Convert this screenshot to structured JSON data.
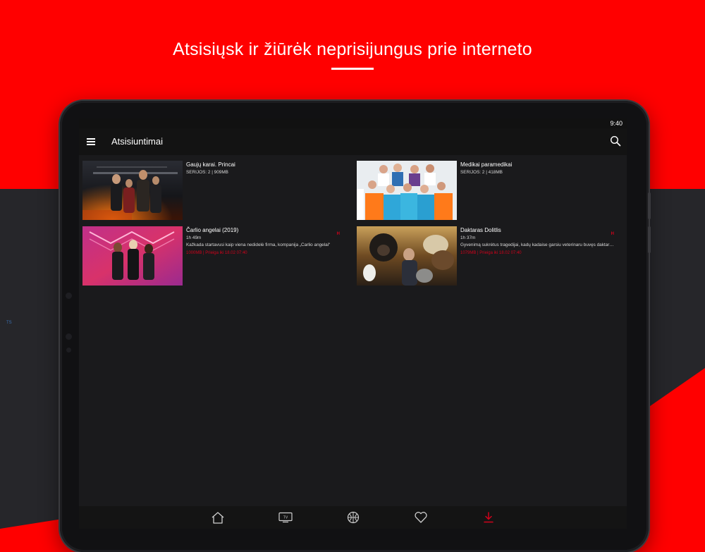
{
  "headline": "Atsisiųsk ir žiūrėk neprisijungus prie interneto",
  "status": {
    "time": "9:40"
  },
  "tablet": {
    "side_label": "TS"
  },
  "appbar": {
    "title": "Atsisiuntimai",
    "menu_icon": "hamburger-menu-icon",
    "search_icon": "search-icon"
  },
  "downloads": [
    {
      "title": "Gaujų karai. Princai",
      "meta": "SERIJOS: 2 | 909MB"
    },
    {
      "title": "Medikai paramedikai",
      "meta": "SERIJOS: 2 | 418MB"
    },
    {
      "title": "Čarlio angelai (2019)",
      "duration": "1h 49m",
      "description": "Kažkada startavusi kaip viena nedidelė firma, kompanija „Čarlio angelai“",
      "red": "1000MB | Prieiga iki 18.02 07:40",
      "badge": "H"
    },
    {
      "title": "Daktaras Dolitlis",
      "duration": "1h 37m",
      "description": "Gyvenimą sukrėtus tragedijai, kadų kadaise garsiu veterinaru buvęs daktaras",
      "red": "1079MB | Prieiga iki 18.02 07:40",
      "badge": "H"
    }
  ],
  "bottom_nav": [
    {
      "name": "home-icon"
    },
    {
      "name": "tv-icon",
      "label": "TV"
    },
    {
      "name": "sports-ball-icon"
    },
    {
      "name": "heart-icon"
    },
    {
      "name": "download-icon",
      "active": true
    }
  ],
  "colors": {
    "accent": "#d0021b",
    "brand_red": "#ff0000",
    "screen_bg": "#1a1a1c"
  }
}
